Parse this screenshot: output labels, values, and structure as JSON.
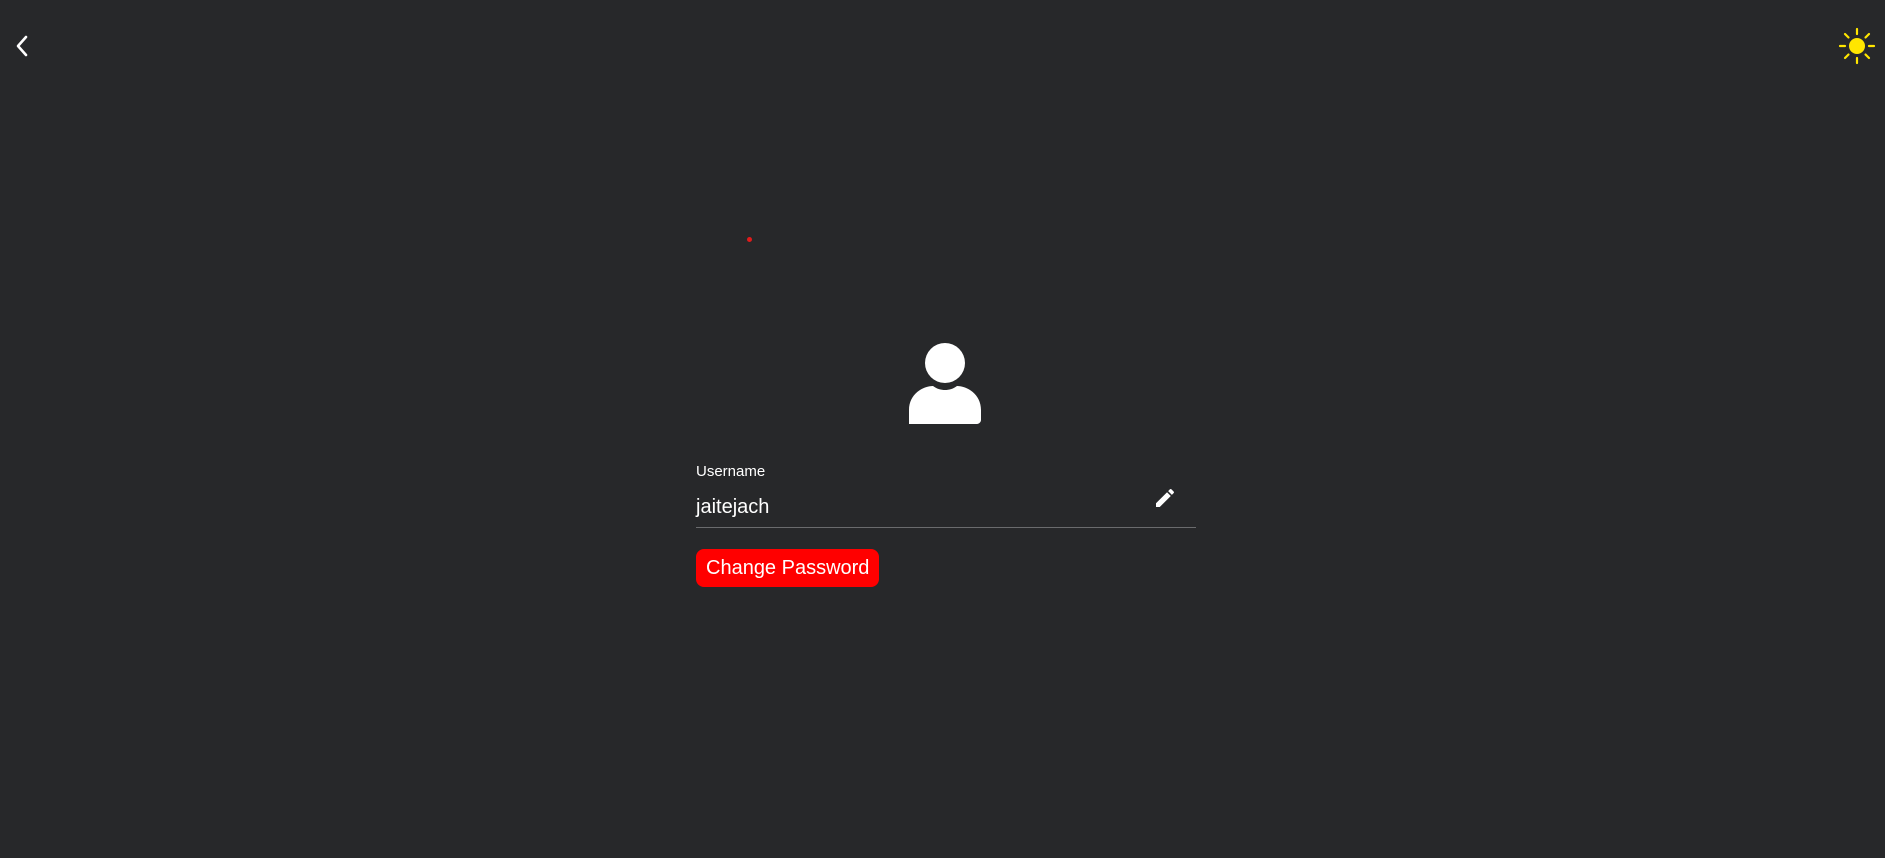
{
  "header": {
    "back_icon": "chevron-left-icon",
    "theme_icon": "sun-icon"
  },
  "profile": {
    "avatar_icon": "user-icon",
    "username_label": "Username",
    "username_value": "jaitejach",
    "edit_icon": "pencil-icon",
    "change_password_label": "Change Password"
  },
  "colors": {
    "background": "#27282a",
    "accent": "#ff0000",
    "sun": "#ffe600",
    "text": "#ffffff"
  }
}
